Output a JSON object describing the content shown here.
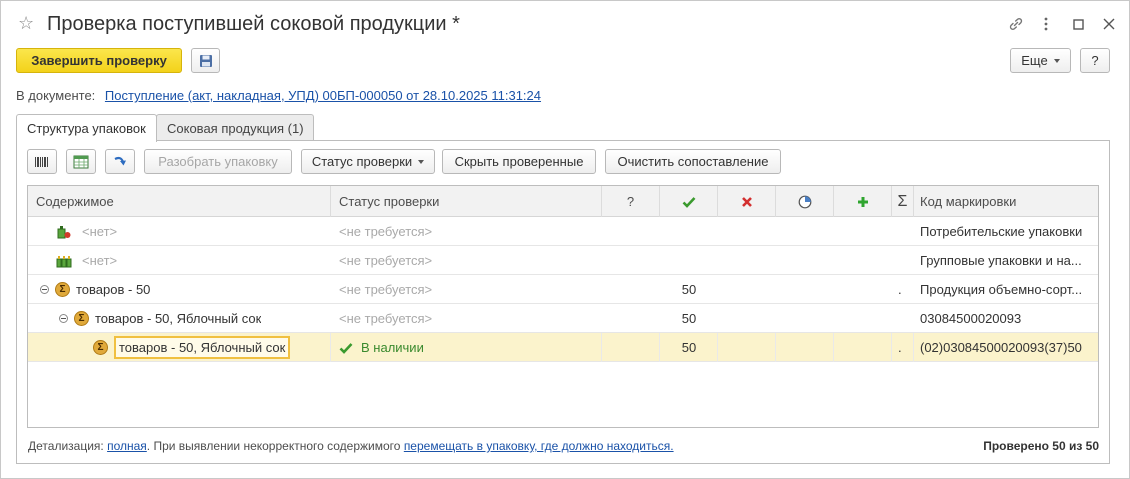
{
  "window": {
    "title": "Проверка поступившей соковой продукции *"
  },
  "toolbar": {
    "finish_label": "Завершить проверку",
    "more_label": "Еще",
    "help_label": "?"
  },
  "document": {
    "label": "В документе:",
    "link": "Поступление (акт, накладная, УПД) 00БП-000050 от 28.10.2025 11:31:24"
  },
  "tabs": [
    {
      "label": "Структура упаковок"
    },
    {
      "label": "Соковая продукция (1)"
    }
  ],
  "panel_toolbar": {
    "unpack_label": "Разобрать упаковку",
    "status_label": "Статус проверки",
    "hide_label": "Скрыть проверенные",
    "clear_label": "Очистить сопоставление"
  },
  "grid": {
    "columns": {
      "content": "Содержимое",
      "status": "Статус проверки",
      "question": "?",
      "sum": "Σ",
      "code": "Код маркировки"
    },
    "rows": [
      {
        "content": "<нет>",
        "status": "<не требуется>",
        "checked": "",
        "dot": "",
        "code": "Потребительские упаковки"
      },
      {
        "content": "<нет>",
        "status": "<не требуется>",
        "checked": "",
        "dot": "",
        "code": "Групповые упаковки и на..."
      },
      {
        "content": "товаров - 50",
        "status": "<не требуется>",
        "checked": "50",
        "dot": ".",
        "code": "Продукция объемно-сорт..."
      },
      {
        "content": "товаров - 50, Яблочный сок",
        "status": "<не требуется>",
        "checked": "50",
        "dot": "",
        "code": "03084500020093"
      },
      {
        "content": "товаров - 50, Яблочный сок",
        "status": "В наличии",
        "checked": "50",
        "dot": ".",
        "code": "(02)03084500020093(37)50"
      }
    ]
  },
  "footer": {
    "detail_label": "Детализация:",
    "detail_link": "полная",
    "middle_text": ". При выявлении некорректного содержимого",
    "move_link": "перемещать в упаковку, где должно находиться.",
    "checked_summary": "Проверено 50 из 50"
  },
  "colors": {
    "primary_button": "#f3d21a",
    "link": "#1a52a8",
    "selected_row": "#fbf3cc",
    "check_green": "#3a9a2e",
    "cross_red": "#d32f2f",
    "plus_green": "#2fa52f"
  }
}
